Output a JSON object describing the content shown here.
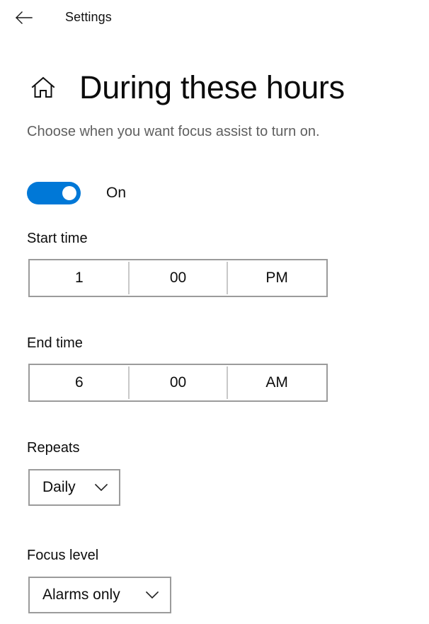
{
  "titlebar": {
    "back_icon": "back-arrow-icon",
    "app_title": "Settings"
  },
  "header": {
    "home_icon": "home-icon",
    "title": "During these hours",
    "subtitle": "Choose when you want focus assist to turn on."
  },
  "toggle": {
    "state_label": "On",
    "checked": true,
    "accent_color": "#0078d7"
  },
  "fields": {
    "start_time": {
      "label": "Start time",
      "hour": "1",
      "minute": "00",
      "period": "PM"
    },
    "end_time": {
      "label": "End time",
      "hour": "6",
      "minute": "00",
      "period": "AM"
    },
    "repeats": {
      "label": "Repeats",
      "value": "Daily",
      "chevron_icon": "chevron-down-icon"
    },
    "focus_level": {
      "label": "Focus level",
      "value": "Alarms only",
      "chevron_icon": "chevron-down-icon"
    }
  },
  "colors": {
    "accent": "#0078d7",
    "border": "#9b9b9b",
    "divider": "#c8c8c8",
    "subtitle_text": "#5f5f5f",
    "primary_text": "#0d0d0d",
    "background": "#ffffff"
  }
}
